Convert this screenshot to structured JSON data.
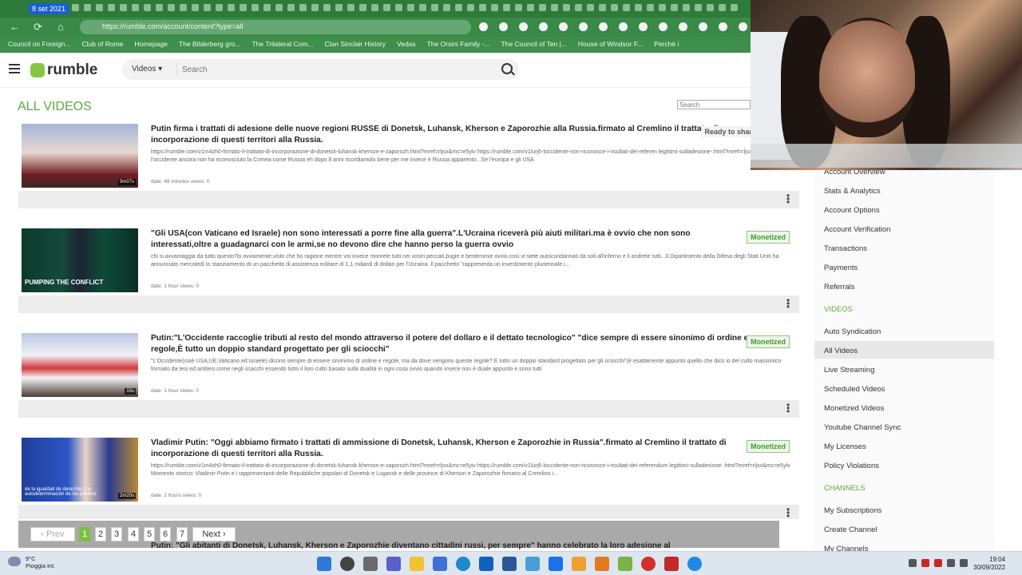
{
  "browser": {
    "tab_date": "8 set 2021",
    "url": "https://rumble.com/account/content?type=all",
    "bookmarks": [
      "Council on Foreign...",
      "Club of Rome",
      "Homepage",
      "The Bilderberg gro...",
      "The Trilateral Com...",
      "Clan Sinclair History",
      "Vedas",
      "The Orsini Family -...",
      "The Council of Ten |...",
      "House of Windsor F...",
      "Perché i"
    ]
  },
  "header": {
    "logo_text": "rumble",
    "search_select": "Videos",
    "search_placeholder": "Search"
  },
  "page": {
    "title": "ALL VIDEOS",
    "filter_placeholder": "Search"
  },
  "videos": [
    {
      "title": "Putin firma i trattati di adesione delle nuove regioni RUSSE di Donetsk, Luhansk, Kherson e Zaporozhie alla Russia.firmato al Cremlino il trattato di incorporazione di questi territori alla Russia.",
      "description": "https://rumble.com/v1m4zh0-firmato-il-trattato-di-incorporazione-di-donetsk-luhansk-kherson-e-zaporozh.html?mref=rljsx&mc=e5yiv https://rumble.com/v1lurj6-loccidente-non-riconosce-i-risultati-dei-referen legittimi-sulladesione-.html?mref=rljsx&mc=e5ylv l'occidente ancora non ha riconosciuto la Crimea come Russia eh dopo 8 anni ricordiamolo bene per me invece è Russia apparento...Se l'europa e gli USA",
      "meta": "date: 48 minutes  views: 0",
      "badge": "Ready to share. Monetization",
      "duration": "9m07s"
    },
    {
      "title": "\"Gli USA(con Vaticano ed Israele) non sono interessati a porre fine alla guerra\".L'Ucraina riceverà più aiuti militari.ma è ovvio che non sono interessati,oltre a guadagnarci con le armi,se no devono dire che hanno perso la guerra ovvio",
      "description": "chi si avvantaggia da tutto questo?lo ovviamente,visto che ho ragione mentre voi invece morirete tutti nei vostri peccati,bugie e bestemmie ovvio.così vi siete autocondannati da soli all'inferno e li andrete tutti...Il Dipartimento della Difesa degli Stati Uniti ha annunciato mercoledì lo stanziamento di un pacchetto di assistenza militare di 1,1 miliardi di dollari per l'Ucraina. Il pacchetto \"rappresenta un investimento pluriennale i...",
      "meta": "date: 1 hour  views: 0",
      "badge": "Monetized",
      "caption": "PUMPING THE CONFLICT"
    },
    {
      "title": "Putin:\"L'Occidente raccoglie tributi al resto del mondo attraverso il potere del dollaro e il dettato tecnologico\" \"dice sempre di essere sinonimo di ordine e regole,È tutto un doppio standard progettato per gli sciocchi\"",
      "description": "\"L'Occidente(cioè USA,UE,Vaticano ed Israele) dicono sempre di essere sinonimo di ordine e regole, ma da dove vengono queste regole? È tutto un doppio standard progettato per gli sciocchi\"(è esattamente appunto quello che dico io del culto massonico formato da tesi ed antitesi come negli scacchi essendo tutto il loro culto basato sulla dualità in ogni cosa ovvio quando invece non è duale appunto e sono tutti",
      "meta": "date: 1 hour  views: 0",
      "badge": "Monetized",
      "duration": "15s"
    },
    {
      "title": "Vladimir Putin: \"Oggi abbiamo firmato i trattati di ammissione di Donetsk, Luhansk, Kherson e Zaporozhie in Russia\".firmato al Cremlino il trattato di incorporazione di questi territori alla Russia.",
      "description": "https://rumble.com/v1m4zh0-firmato-il-trattato-di-incorporazione-di-donetsk-luhansk-kherson-e-zaporozh.html?mref=rljsx&mc=e5yiv https://rumble.com/v1lurj6-loccidente-non-riconosce-i-risultati-dei-referendum legittimi-sulladesione-.html?mref=rljsx&mc=e5ylv Momento storico: Vladimir Putin e i rappresentanti delle Repubbliche popolari di Donetsk e Lugansk e delle province di Kherson e Zaporozhie firmano al Cremlino i...",
      "meta": "date: 2 hours  views: 0",
      "badge": "Monetized",
      "duration": "2m20s",
      "caption": "de la igualdad de derechos y la autodeterminación de los pueblos"
    }
  ],
  "next_video_title": "Putin: \"Gli abitanti di Donetsk, Luhansk, Kherson e Zaporozhie diventano cittadini russi, per sempre\" hanno celebrato la loro adesione al",
  "pagination": {
    "prev": "Prev",
    "pages": [
      "1",
      "2",
      "3",
      "4",
      "5",
      "6",
      "7"
    ],
    "current": "1",
    "next": "Next"
  },
  "sidebar": {
    "account_items": [
      "Account Overview",
      "Stats & Analytics",
      "Account Options",
      "Account Verification",
      "Transactions",
      "Payments",
      "Referrals"
    ],
    "videos_header": "VIDEOS",
    "video_items": [
      "Auto Syndication",
      "All Videos",
      "Live Streaming",
      "Scheduled Videos",
      "Monetized Videos",
      "Youtube Channel Sync",
      "My Licenses",
      "Policy Violations"
    ],
    "channels_header": "CHANNELS",
    "channel_items": [
      "My Subscriptions",
      "Create Channel",
      "My Channels"
    ],
    "active": "All Videos"
  },
  "taskbar": {
    "temperature": "9°C",
    "weather": "Pioggia int.",
    "time": "19:04",
    "date": "30/09/2022"
  },
  "colors": {
    "accent": "#5aaa3b",
    "browser_green": "#3a8a47",
    "monetized": "#3e9a30"
  }
}
